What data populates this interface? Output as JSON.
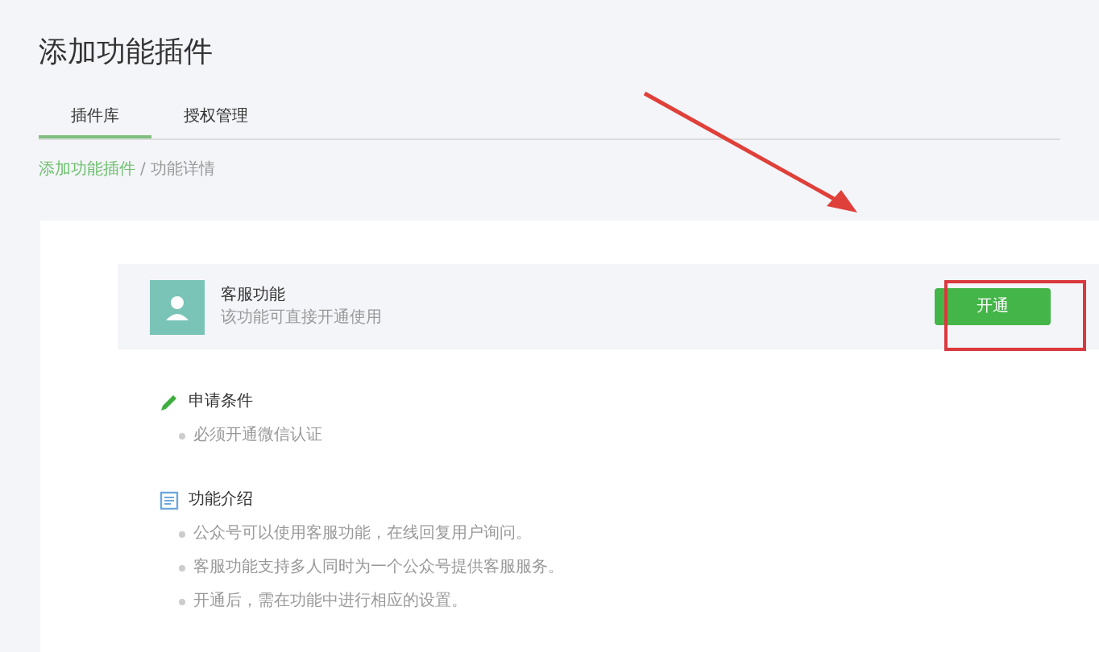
{
  "page_title": "添加功能插件",
  "tabs": [
    {
      "label": "插件库",
      "selected": true
    },
    {
      "label": "授权管理",
      "selected": false
    }
  ],
  "breadcrumb": {
    "link": "添加功能插件",
    "separator": "/",
    "current": "功能详情"
  },
  "plugin": {
    "name": "客服功能",
    "description": "该功能可直接开通使用",
    "button": "开通"
  },
  "sections": [
    {
      "kind": "pencil",
      "title": "申请条件",
      "items": [
        "必须开通微信认证"
      ]
    },
    {
      "kind": "document",
      "title": "功能介绍",
      "items": [
        "公众号可以使用客服功能，在线回复用户询问。",
        "客服功能支持多人同时为一个公众号提供客服服务。",
        "开通后，需在功能中进行相应的设置。"
      ]
    }
  ]
}
